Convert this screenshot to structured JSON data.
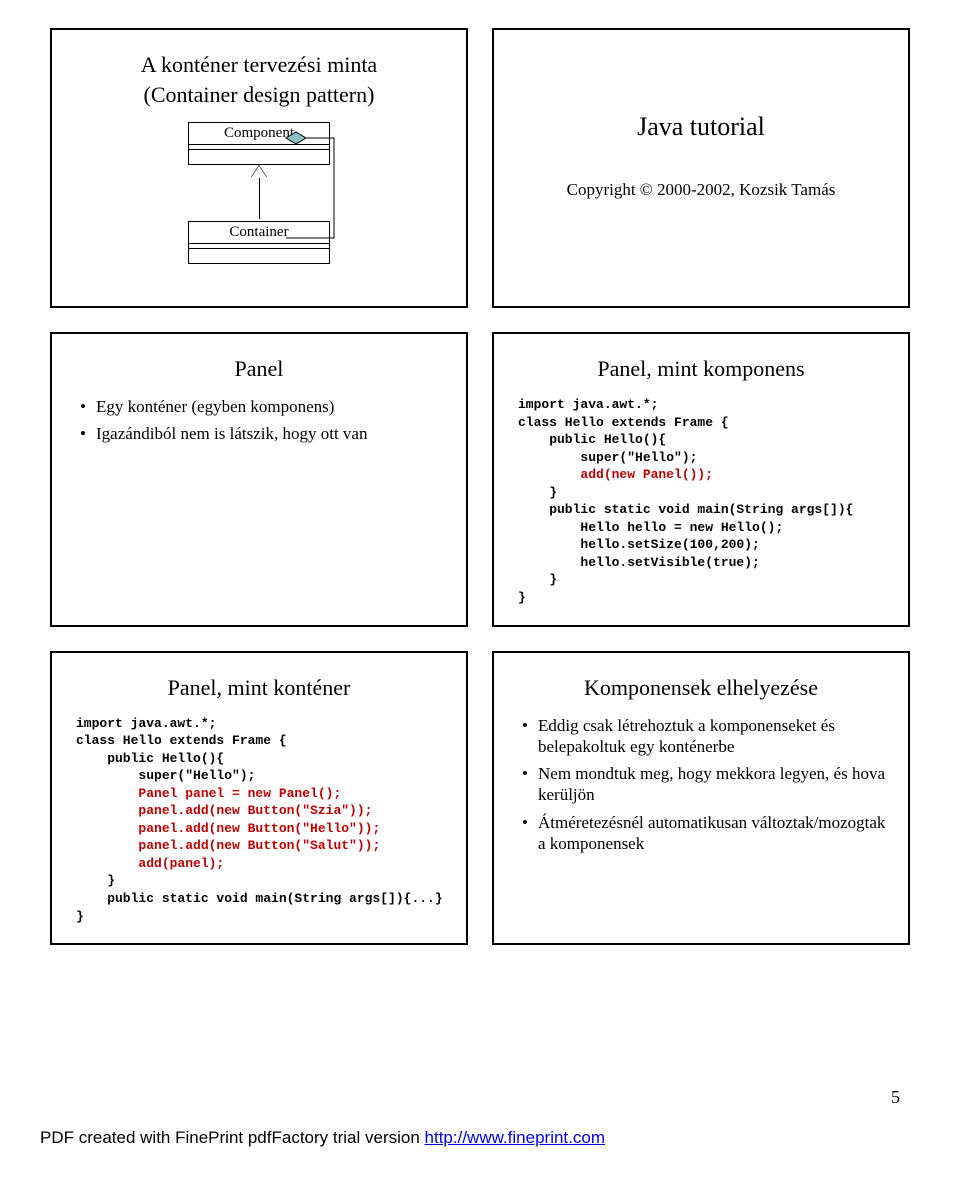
{
  "slide1": {
    "title1": "A konténer tervezési minta",
    "title2": "(Container design pattern)",
    "uml_top": "Component",
    "uml_bottom": "Container"
  },
  "slide2": {
    "title": "Java tutorial",
    "copyright": "Copyright © 2000-2002, Kozsik Tamás"
  },
  "slide3": {
    "title": "Panel",
    "b1": "Egy konténer (egyben komponens)",
    "b2": "Igazándiból nem is látszik, hogy ott van"
  },
  "slide4": {
    "title": "Panel, mint komponens",
    "c1": "import java.awt.*;",
    "c2": "class Hello extends Frame {",
    "c3": "    public Hello(){",
    "c4": "        super(\"Hello\");",
    "c5_red": "        add(new Panel());",
    "c6": "    }",
    "c7": "    public static void main(String args[]){",
    "c8": "        Hello hello = new Hello();",
    "c9": "        hello.setSize(100,200);",
    "c10": "        hello.setVisible(true);",
    "c11": "    }",
    "c12": "}"
  },
  "slide5": {
    "title": "Panel, mint konténer",
    "c1": "import java.awt.*;",
    "c2": "class Hello extends Frame {",
    "c3": "    public Hello(){",
    "c4": "        super(\"Hello\");",
    "c5_red": "        Panel panel = new Panel();",
    "c6_red": "        panel.add(new Button(\"Szia\"));",
    "c7_red": "        panel.add(new Button(\"Hello\"));",
    "c8_red": "        panel.add(new Button(\"Salut\"));",
    "c9_red": "        add(panel);",
    "c10": "    }",
    "c11": "    public static void main(String args[]){...}",
    "c12": "}"
  },
  "slide6": {
    "title": "Komponensek elhelyezése",
    "b1": "Eddig csak létrehoztuk a komponenseket és belepakoltuk egy konténerbe",
    "b2": "Nem mondtuk meg, hogy mekkora legyen, és hova kerüljön",
    "b3": "Átméretezésnél automatikusan változtak/mozogtak a komponensek"
  },
  "pagenum": "5",
  "footer": {
    "text": "PDF created with FinePrint pdfFactory trial version ",
    "link": "http://www.fineprint.com"
  }
}
